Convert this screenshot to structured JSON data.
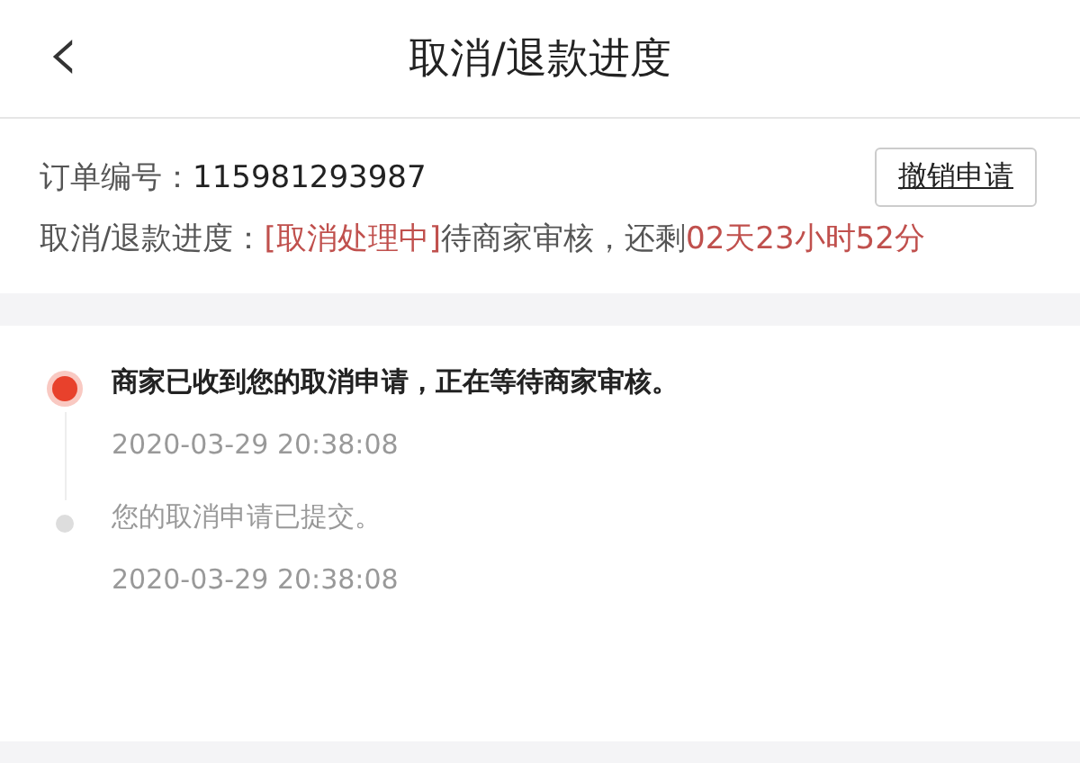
{
  "header": {
    "back_icon": "‹",
    "title": "取消/退款进度"
  },
  "order": {
    "label": "订单编号：",
    "number": "115981293987",
    "revoke_button": "撤销申请"
  },
  "progress": {
    "label": "取消/退款进度：",
    "segments": [
      {
        "text": "[取消处理中]",
        "highlight": true
      },
      {
        "text": "待商家审核，还剩",
        "highlight": false
      },
      {
        "text": "02天23小时52分",
        "highlight": true
      }
    ]
  },
  "timeline": [
    {
      "message": "商家已收到您的取消申请，正在等待商家审核。",
      "time": "2020-03-29 20:38:08",
      "active": true
    },
    {
      "message": "您的取消申请已提交。",
      "time": "2020-03-29 20:38:08",
      "active": false
    }
  ]
}
